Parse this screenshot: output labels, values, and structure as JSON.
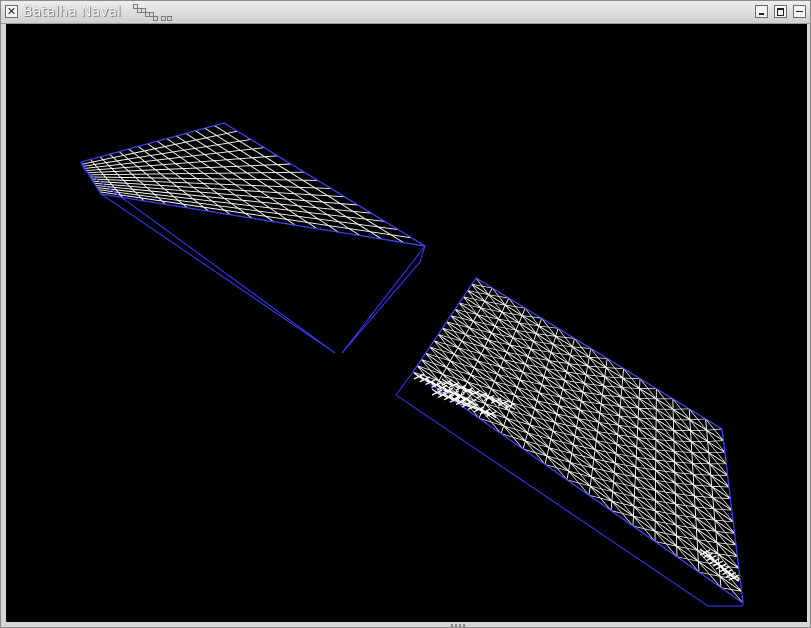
{
  "window": {
    "title": "Batalha Naval",
    "icons": {
      "close": "close-x-icon",
      "minimize": "minimize-icon",
      "maximize": "maximize-icon",
      "shade": "shade-icon"
    }
  },
  "scene": {
    "background": "#000000",
    "grid_color": "#ffffff",
    "edge_color": "#3b3bff",
    "boards": [
      {
        "name": "player-board",
        "grid_size": 15,
        "style": "square-grid"
      },
      {
        "name": "enemy-board",
        "grid_size": 15,
        "style": "triangulated-grid"
      }
    ]
  }
}
